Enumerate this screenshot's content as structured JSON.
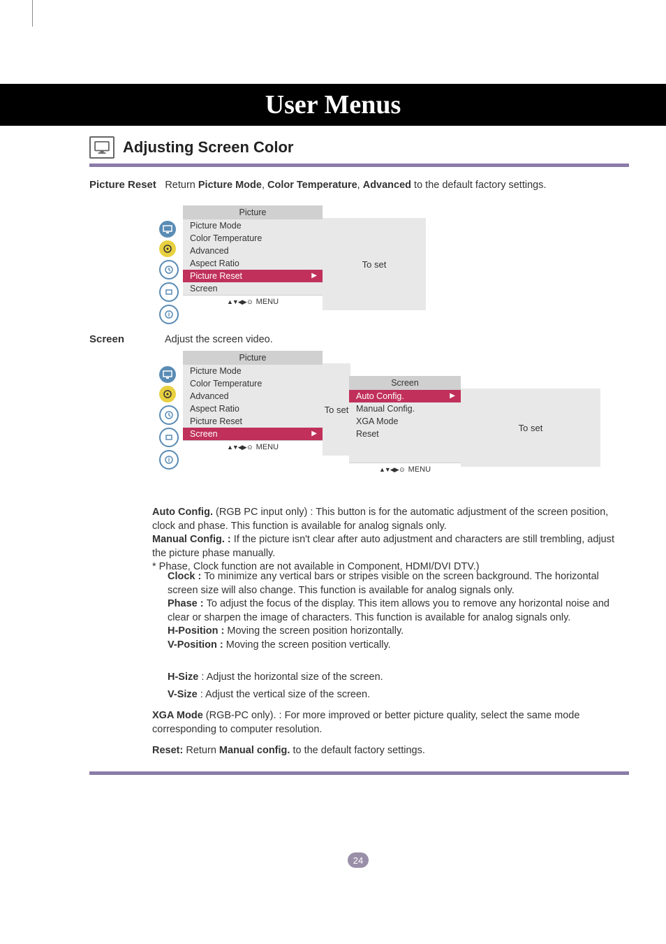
{
  "banner_title": "User Menus",
  "section_title": "Adjusting Screen Color",
  "picture_reset": {
    "label": "Picture Reset",
    "desc_prefix": "Return ",
    "desc_bold1": "Picture Mode",
    "desc_sep1": ", ",
    "desc_bold2": "Color Temperature",
    "desc_sep2": ",  ",
    "desc_bold3": "Advanced",
    "desc_suffix": " to  the default factory settings."
  },
  "menu1": {
    "header": "Picture",
    "items": [
      "Picture Mode",
      "Color Temperature",
      "Advanced",
      "Aspect Ratio",
      "Picture Reset",
      "Screen"
    ],
    "selected_index": 4,
    "footer_nav": "▲▼◀▶ ⊙",
    "footer_label": "MENU",
    "toset": "To set"
  },
  "screen_section": {
    "label": "Screen",
    "desc": "Adjust the screen video."
  },
  "menu2": {
    "header": "Picture",
    "items": [
      "Picture Mode",
      "Color Temperature",
      "Advanced",
      "Aspect Ratio",
      "Picture Reset",
      "Screen"
    ],
    "selected_index": 5,
    "footer_nav": "▲▼◀▶ ⊙",
    "footer_label": "MENU",
    "toset": "To set"
  },
  "submenu": {
    "header": "Screen",
    "items": [
      "Auto Config.",
      "Manual Config.",
      "XGA Mode",
      "Reset"
    ],
    "selected_index": 0,
    "footer_nav": "▲▼◀▶ ⊙",
    "footer_label": "MENU",
    "toset": "To set"
  },
  "body": {
    "auto_label": "Auto Config.",
    "auto_note": " (RGB PC input only) : ",
    "auto_text": "This button is for the automatic adjustment of the screen position, clock and phase. This function is available for analog signals only.",
    "manual_label": "Manual Config. : ",
    "manual_text": "If the picture isn't clear after auto adjustment and characters are still trembling, adjust the picture phase manually.",
    "note_star": "* Phase, Clock function are not available in Component, HDMI/DVI DTV.)",
    "clock_label": "Clock : ",
    "clock_text": "To minimize any vertical bars or stripes visible on the screen background. The horizontal screen size will also change. This function is available for analog signals only.",
    "phase_label": "Phase : ",
    "phase_text": "To adjust the focus of the display. This item allows you to remove any horizontal noise and clear or sharpen the image of characters. This function is available for analog signals only.",
    "hpos_label": "H-Position : ",
    "hpos_text": "Moving the screen position horizontally.",
    "vpos_label": "V-Position : ",
    "vpos_text": "Moving the screen position vertically.",
    "hsize_label": "H-Size",
    "hsize_text": "  : Adjust the horizontal size of the screen.",
    "vsize_label": "V-Size",
    "vsize_text": "  : Adjust the vertical size of the screen.",
    "xga_label": "XGA Mode",
    "xga_note": " (RGB-PC only). : ",
    "xga_text": "For more improved or better picture quality, select the same mode corresponding to computer resolution.",
    "reset_label": "Reset: ",
    "reset_prefix": "Return ",
    "reset_bold": "Manual config.",
    "reset_suffix": " to the default factory settings."
  },
  "page_number": "24"
}
